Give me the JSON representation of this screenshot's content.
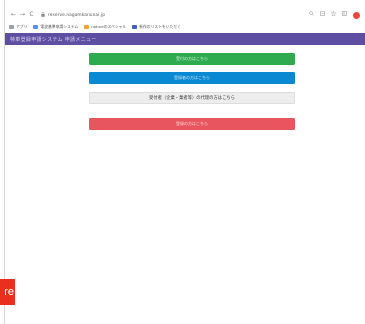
{
  "browser": {
    "nav": {
      "back": "←",
      "forward": "→",
      "reload": "C"
    },
    "lock_icon": "lock-icon",
    "url": "reserve.nagamkanunai.jp",
    "right_icons": [
      "search-icon",
      "share-icon",
      "star-icon",
      "sidebar-icon"
    ],
    "profile_color": "#e8473b"
  },
  "bookmarks": [
    {
      "icon": "apps-icon",
      "label": "アプリ",
      "color": "#9aa0a6"
    },
    {
      "icon": "site-icon",
      "label": "電波基準申請システム",
      "color": "#5b8def"
    },
    {
      "icon": "site-icon",
      "label": "natureのスペシャル",
      "color": "#f2a33a"
    },
    {
      "icon": "site-icon",
      "label": "新作のリストをいただく",
      "color": "#3a5fc6"
    }
  ],
  "header": {
    "title": "特車登録申請システム 申請メニュー",
    "color": "#5e4fa2"
  },
  "menu": {
    "green_label": "受付の方はこちら",
    "blue_label": "登録者の方はこちら",
    "light_label": "受付者（企業・業者等）の代理の方はこちら",
    "red_label": "登録の方はこちら"
  },
  "colors": {
    "green": "#2fab4f",
    "blue": "#0a88d2",
    "light": "#ededed",
    "red": "#e8555e"
  },
  "corner_tab": {
    "text": "re",
    "color": "#e8301c"
  }
}
